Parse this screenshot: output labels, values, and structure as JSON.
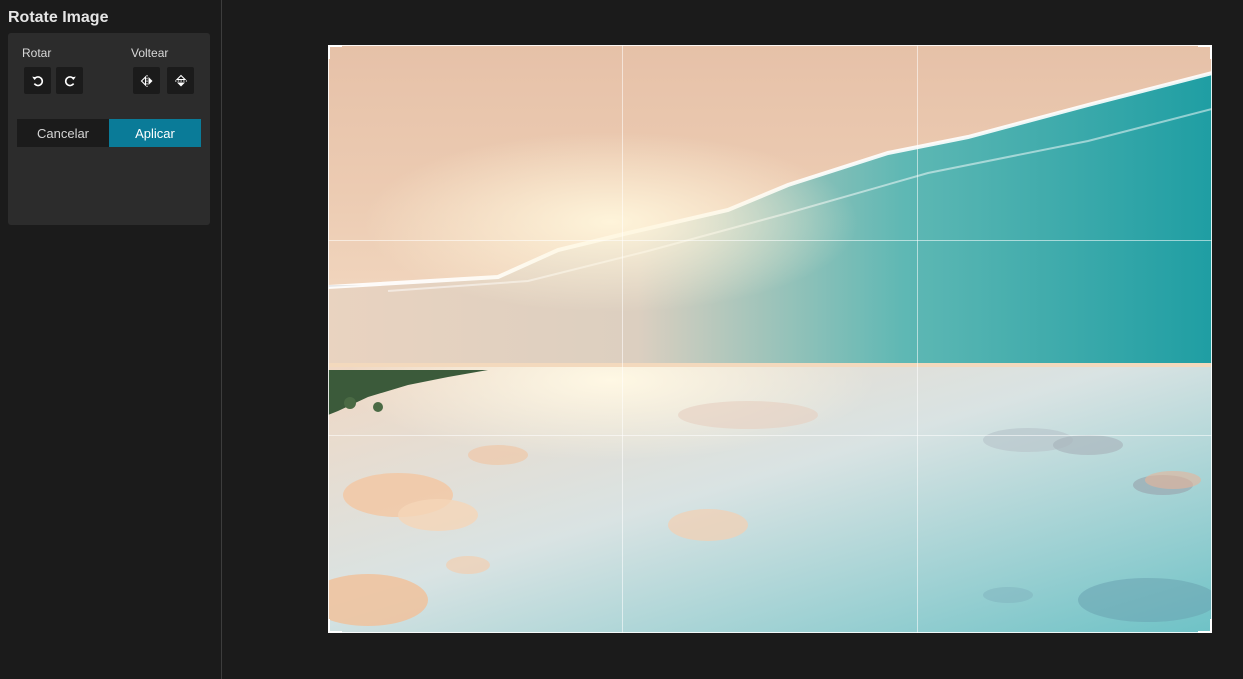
{
  "panel": {
    "title": "Rotate Image",
    "rotate_label": "Rotar",
    "flip_label": "Voltear",
    "buttons": {
      "rotate_ccw_icon": "rotate-counterclockwise-icon",
      "rotate_cw_icon": "rotate-clockwise-icon",
      "flip_horizontal_icon": "flip-horizontal-icon",
      "flip_vertical_icon": "flip-vertical-icon"
    },
    "cancel_label": "Cancelar",
    "apply_label": "Aplicar"
  },
  "canvas": {
    "image_description_colors": {
      "sand": "#e8c4a8",
      "sea": "#2aa6a8",
      "sky": "#cfe0e4",
      "sun": "#fff4d6"
    },
    "crop_grid": "3x3"
  },
  "colors": {
    "background": "#1b1b1b",
    "panel": "#2c2c2c",
    "accent": "#0a7b98"
  }
}
